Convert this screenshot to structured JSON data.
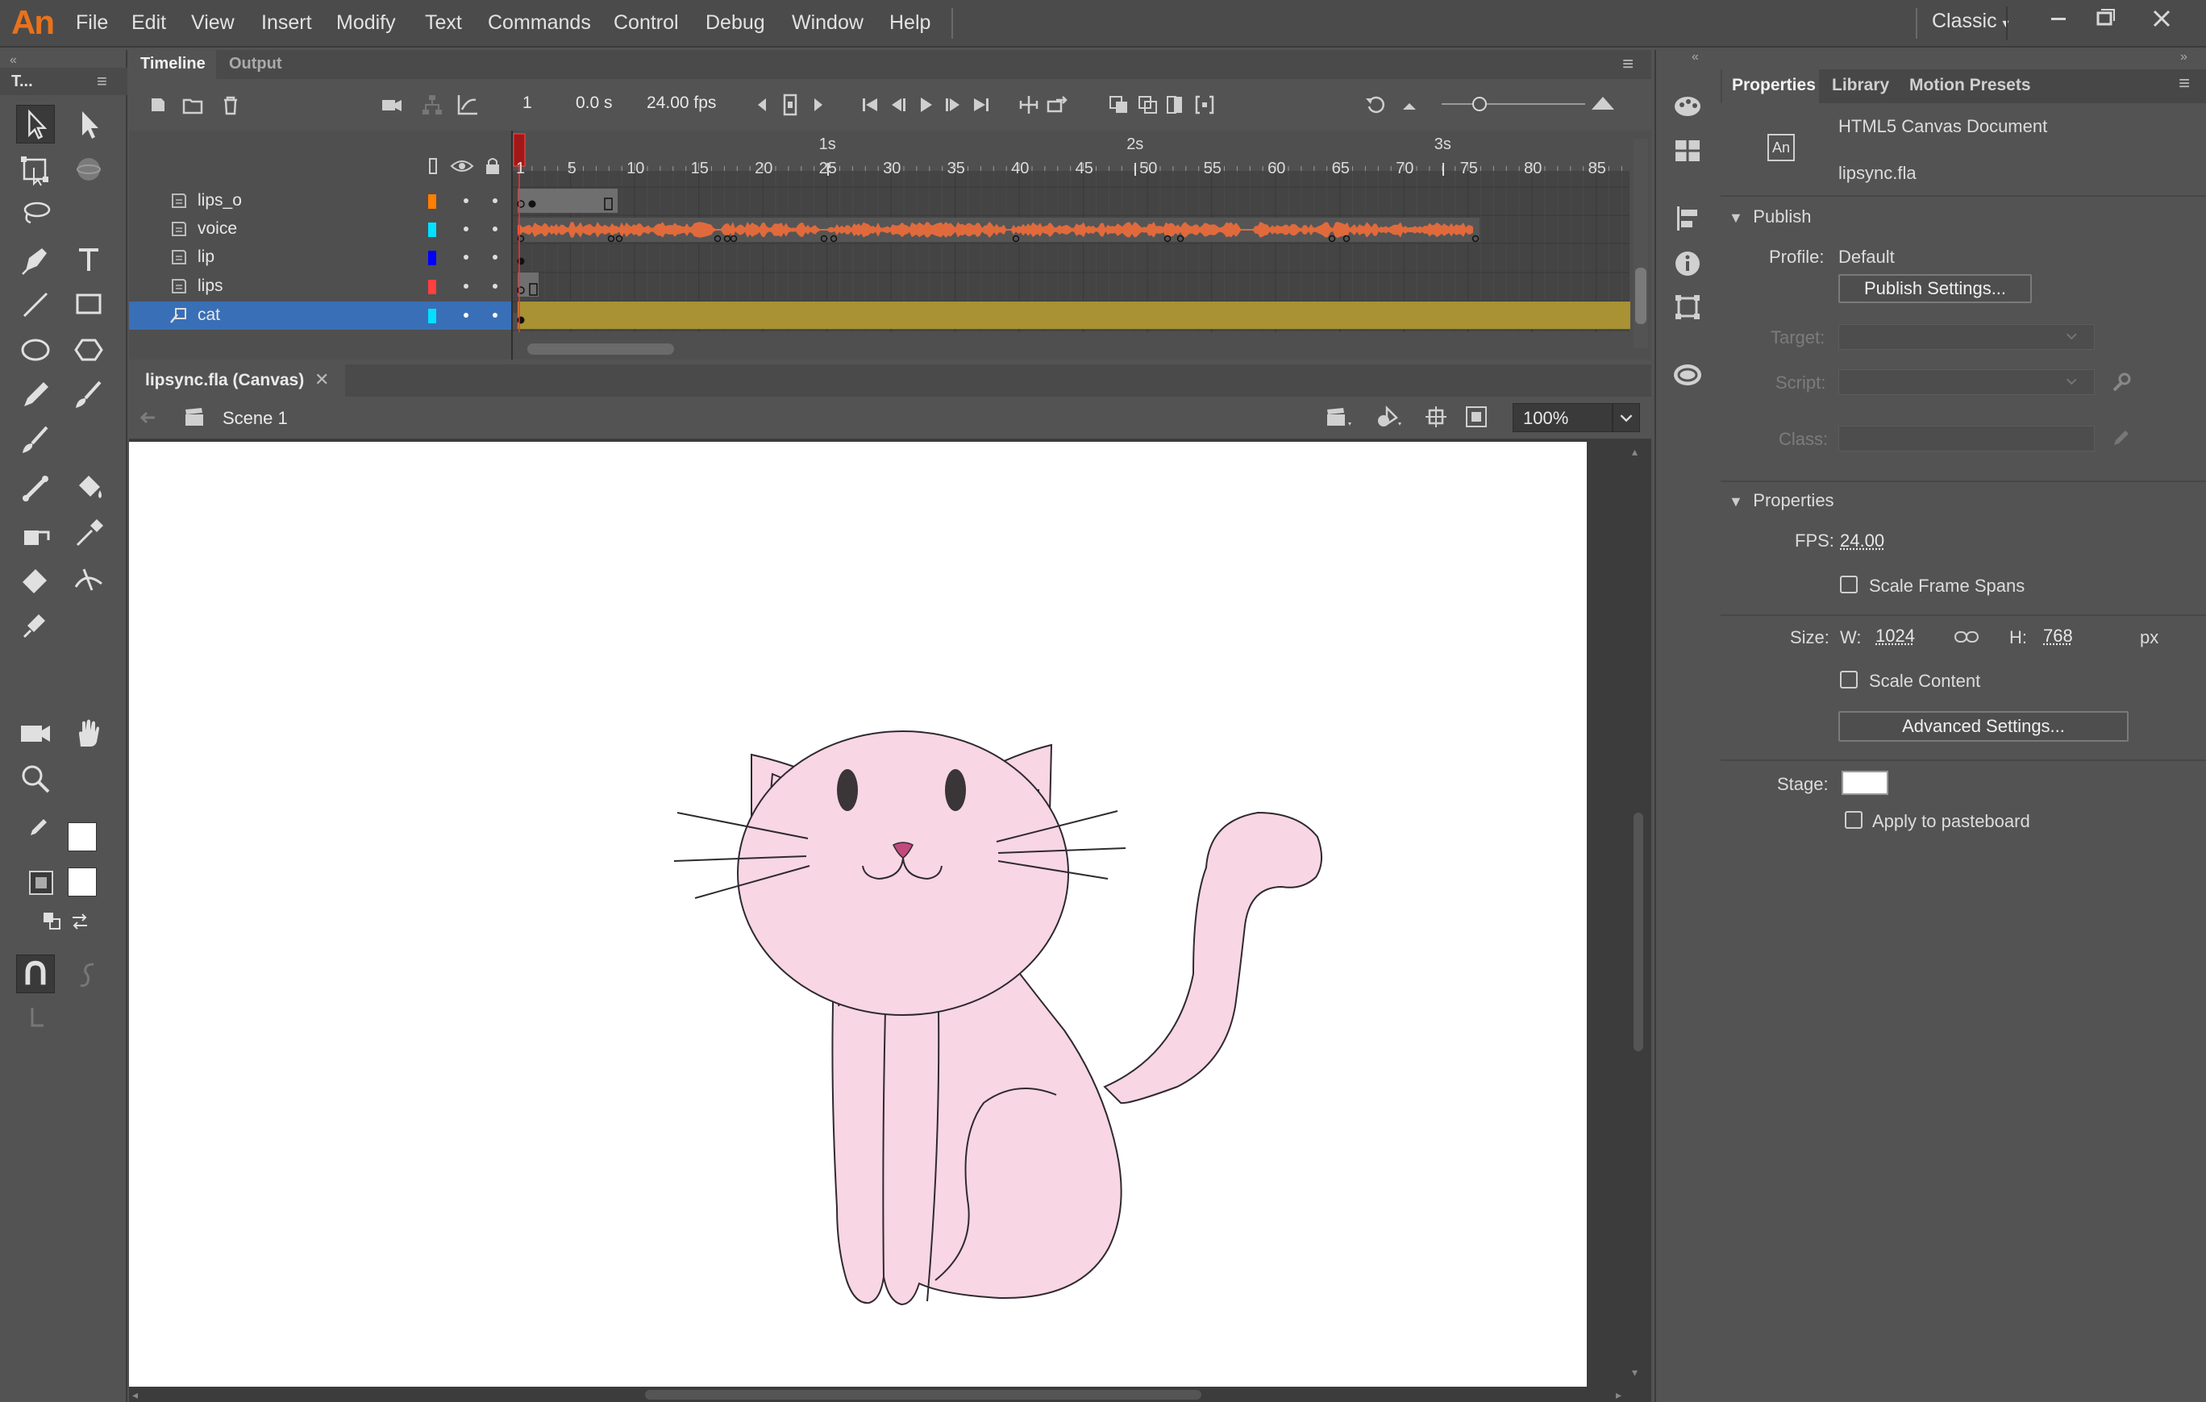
{
  "app": {
    "logo": "An",
    "workspace": "Classic",
    "workspace_icon": "chevron-down-icon",
    "window_controls": [
      "minimize-icon",
      "restore-icon",
      "close-icon"
    ]
  },
  "menu": [
    "File",
    "Edit",
    "View",
    "Insert",
    "Modify",
    "Text",
    "Commands",
    "Control",
    "Debug",
    "Window",
    "Help"
  ],
  "tools": {
    "panel_title": "T...",
    "items": [
      "selection-tool",
      "subselection-tool",
      "free-transform-tool",
      "3d-rotation-tool",
      "lasso-tool",
      "pen-tool",
      "text-tool",
      "line-tool",
      "rectangle-tool",
      "oval-tool",
      "polystar-tool",
      "pencil-tool",
      "paint-brush-tool",
      "brush-tool",
      "bone-tool",
      "paint-bucket-tool",
      "ink-bottle-tool",
      "eyedropper-tool",
      "eraser-tool",
      "width-tool",
      "pin-tool",
      "camera-tool",
      "hand-tool",
      "zoom-tool",
      "stroke-color",
      "fill-color",
      "swap-colors",
      "snap-to-objects",
      "smooth"
    ],
    "stroke_color": "#ffffff",
    "fill_color": "#ffffff"
  },
  "timeline": {
    "tabs": [
      "Timeline",
      "Output"
    ],
    "active_tab": "Timeline",
    "current_frame": "1",
    "elapsed": "0.0 s",
    "fps": "24.00 fps",
    "second_markers": [
      "1s",
      "2s",
      "3s"
    ],
    "frame_numbers": [
      "1",
      "5",
      "10",
      "15",
      "20",
      "25",
      "30",
      "35",
      "40",
      "45",
      "50",
      "55",
      "60",
      "65",
      "70",
      "75",
      "80",
      "85"
    ],
    "layers": [
      {
        "name": "lips_o",
        "color": "#ff7f00",
        "selected": false,
        "type": "normal"
      },
      {
        "name": "voice",
        "color": "#00e0ff",
        "selected": false,
        "type": "normal"
      },
      {
        "name": "lip",
        "color": "#0000ff",
        "selected": false,
        "type": "normal"
      },
      {
        "name": "lips",
        "color": "#ff4040",
        "selected": false,
        "type": "normal"
      },
      {
        "name": "cat",
        "color": "#00e0ff",
        "selected": true,
        "type": "camera"
      }
    ],
    "waveform_color": "#e06a3c",
    "cat_span_color": "#a89233"
  },
  "document": {
    "tab": "lipsync.fla (Canvas)",
    "scene": "Scene 1",
    "zoom": "100%",
    "stage_color": "#ffffff",
    "cat_fill": "#f8d6e4",
    "cat_nose": "#c04a7c"
  },
  "properties": {
    "tabs": [
      "Properties",
      "Library",
      "Motion Presets"
    ],
    "active_tab": "Properties",
    "doc_type": "HTML5 Canvas Document",
    "doc_icon": "An",
    "filename": "lipsync.fla",
    "publish": {
      "section": "Publish",
      "profile_label": "Profile:",
      "profile_value": "Default",
      "settings_button": "Publish Settings...",
      "target_label": "Target:",
      "script_label": "Script:",
      "class_label": "Class:"
    },
    "props": {
      "section": "Properties",
      "fps_label": "FPS:",
      "fps_value": "24.00",
      "scale_frame_spans": "Scale Frame Spans",
      "size_label": "Size:",
      "w_label": "W:",
      "w_value": "1024",
      "h_label": "H:",
      "h_value": "768",
      "unit": "px",
      "scale_content": "Scale Content",
      "advanced_button": "Advanced Settings...",
      "stage_label": "Stage:",
      "apply_pasteboard": "Apply to pasteboard"
    }
  }
}
